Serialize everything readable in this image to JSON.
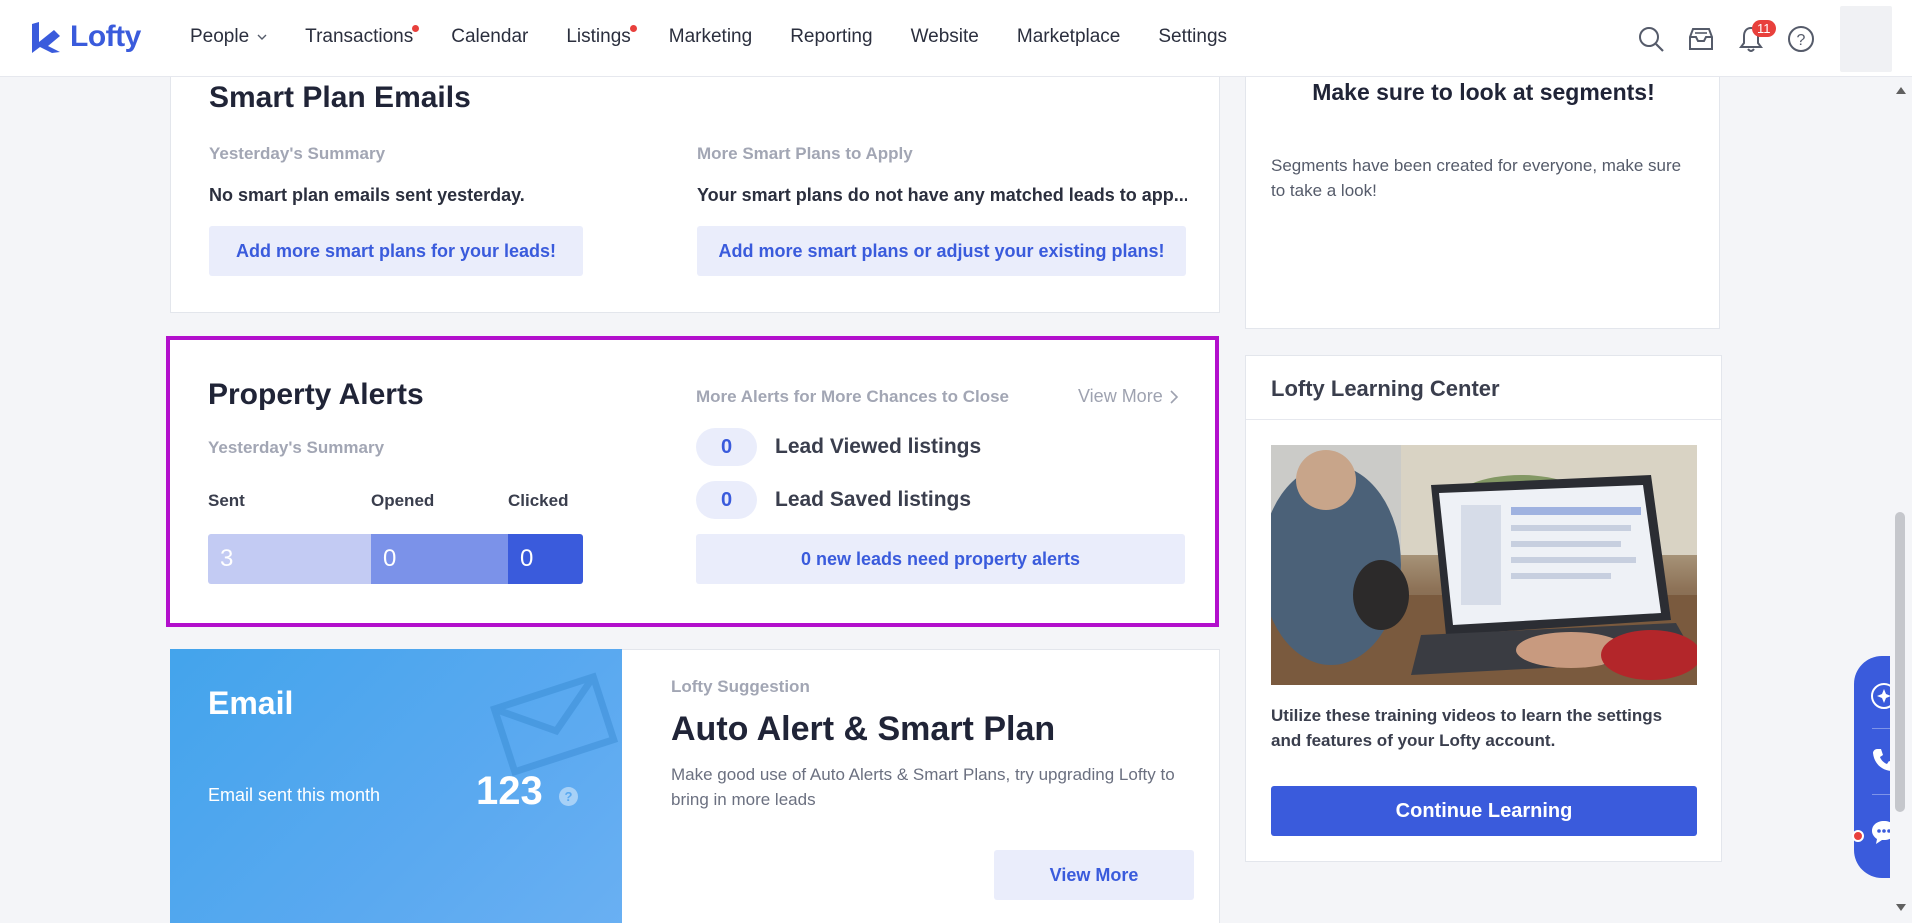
{
  "nav": {
    "logo": "Lofty",
    "items": [
      {
        "label": "People",
        "dot": false,
        "chevron": true
      },
      {
        "label": "Transactions",
        "dot": true,
        "chevron": false
      },
      {
        "label": "Calendar",
        "dot": false,
        "chevron": false
      },
      {
        "label": "Listings",
        "dot": true,
        "chevron": false
      },
      {
        "label": "Marketing",
        "dot": false,
        "chevron": false
      },
      {
        "label": "Reporting",
        "dot": false,
        "chevron": false
      },
      {
        "label": "Website",
        "dot": false,
        "chevron": false
      },
      {
        "label": "Marketplace",
        "dot": false,
        "chevron": false
      },
      {
        "label": "Settings",
        "dot": false,
        "chevron": false
      }
    ],
    "notification_count": "11",
    "icons": [
      "search-icon",
      "inbox-icon",
      "bell-icon",
      "help-icon"
    ]
  },
  "smart_plan": {
    "title": "Smart Plan Emails",
    "left_subtitle": "Yesterday's Summary",
    "left_text": "No smart plan emails sent yesterday.",
    "left_button": "Add more smart plans for your leads!",
    "right_subtitle": "More Smart Plans to Apply",
    "right_text": "Your smart plans do not have any matched leads to app...",
    "right_button": "Add more smart plans or adjust your existing plans!"
  },
  "segments": {
    "title": "Make sure to look at segments!",
    "text": "Segments have been created for everyone, make sure to take a look!"
  },
  "property_alerts": {
    "title": "Property Alerts",
    "subtitle": "Yesterday's Summary",
    "stats": [
      {
        "label": "Sent",
        "value": "3"
      },
      {
        "label": "Opened",
        "value": "0"
      },
      {
        "label": "Clicked",
        "value": "0"
      }
    ],
    "right_subtitle": "More Alerts for More Chances to Close",
    "view_more": "View More",
    "alerts": [
      {
        "count": "0",
        "label": "Lead Viewed listings"
      },
      {
        "count": "0",
        "label": "Lead Saved listings"
      }
    ],
    "new_leads_button": "0 new leads need property alerts"
  },
  "email": {
    "title": "Email",
    "sent_label": "Email sent this month",
    "sent_count": "123",
    "help": "?",
    "suggestion_label": "Lofty Suggestion",
    "suggestion_title": "Auto Alert & Smart Plan",
    "suggestion_text": "Make good use of Auto Alerts & Smart Plans, try upgrading Lofty to bring in more leads",
    "view_more_button": "View More"
  },
  "learning": {
    "title": "Lofty Learning Center",
    "text": "Utilize these training videos to learn the settings and features of your Lofty account.",
    "button": "Continue Learning"
  },
  "colors": {
    "brand": "#3a5bdc",
    "highlight_border": "#b20fcc",
    "sent_bar": "#c3cbf3",
    "opened_bar": "#7b92e9",
    "clicked_bar": "#3a5bdc",
    "notification": "#e8403c"
  }
}
